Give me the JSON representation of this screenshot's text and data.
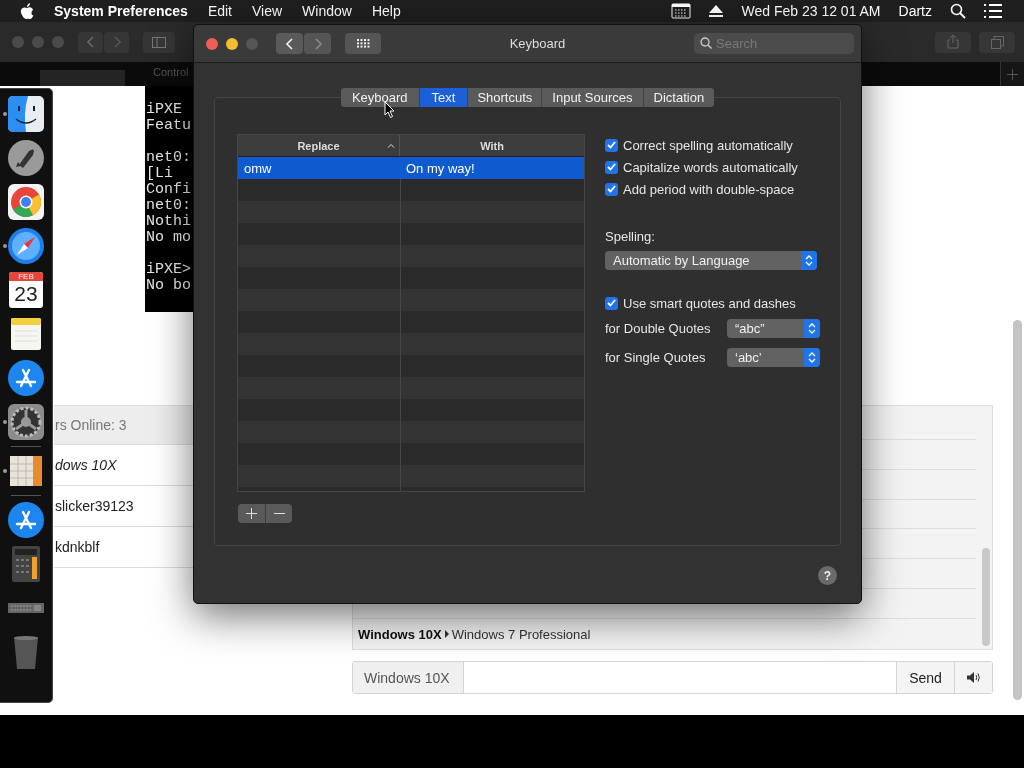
{
  "menu_bar": {
    "app": "System Preferences",
    "menus": [
      "Edit",
      "View",
      "Window",
      "Help"
    ],
    "clock": "Wed Feb 23  12 01 AM",
    "user": "Dartz"
  },
  "browser": {
    "tab_label": "Control",
    "terminal_blocks": [
      [
        "iPXE",
        "Featu"
      ],
      [
        "net0:",
        "[Li",
        "Confi",
        "net0:",
        "Nothi",
        "No mo"
      ],
      [
        "iPXE>",
        "No bo"
      ]
    ],
    "users_header": "rs Online: 3",
    "users": [
      {
        "name": "dows 10X",
        "self": true
      },
      {
        "name": "slicker39123",
        "self": false
      },
      {
        "name": "kdnkblf",
        "self": false
      }
    ],
    "messages": [
      {
        "sender": "Windows 10X",
        "text": "Windows 7 Professional"
      }
    ],
    "name_label": "Windows 10X",
    "send": "Send"
  },
  "dock": {
    "items": [
      {
        "kind": "finder",
        "running": true
      },
      {
        "kind": "launchpad",
        "running": false
      },
      {
        "kind": "chrome",
        "running": false
      },
      {
        "kind": "safari",
        "running": true
      },
      {
        "kind": "calendar",
        "running": false,
        "month": "FEB",
        "day": "23"
      },
      {
        "kind": "notes",
        "running": false
      },
      {
        "kind": "appstore",
        "running": false
      },
      {
        "kind": "preferences",
        "running": true
      },
      {
        "kind": "separator"
      },
      {
        "kind": "spreadsheet",
        "running": true
      },
      {
        "kind": "separator"
      },
      {
        "kind": "appstore",
        "running": false
      },
      {
        "kind": "calculator",
        "running": false
      },
      {
        "kind": "keyboard",
        "running": false
      },
      {
        "kind": "trash",
        "running": false
      }
    ]
  },
  "keyboard_window": {
    "title": "Keyboard",
    "search_placeholder": "Search",
    "tabs": [
      {
        "label": "Keyboard",
        "selected": false
      },
      {
        "label": "Text",
        "selected": true
      },
      {
        "label": "Shortcuts",
        "selected": false
      },
      {
        "label": "Input Sources",
        "selected": false
      },
      {
        "label": "Dictation",
        "selected": false
      }
    ],
    "table": {
      "columns": [
        "Replace",
        "With"
      ],
      "rows": [
        {
          "replace": "omw",
          "with": "On my way!",
          "selected": true
        }
      ]
    },
    "options": [
      {
        "label": "Correct spelling automatically",
        "checked": true
      },
      {
        "label": "Capitalize words automatically",
        "checked": true
      },
      {
        "label": "Add period with double-space",
        "checked": true
      }
    ],
    "spelling_label": "Spelling:",
    "spelling_value": "Automatic by Language",
    "smart_quotes": {
      "label": "Use smart quotes and dashes",
      "checked": true
    },
    "double_quotes": {
      "label": "for Double Quotes",
      "value": "“abc”"
    },
    "single_quotes": {
      "label": "for Single Quotes",
      "value": "‘abc’"
    },
    "help": "?"
  }
}
